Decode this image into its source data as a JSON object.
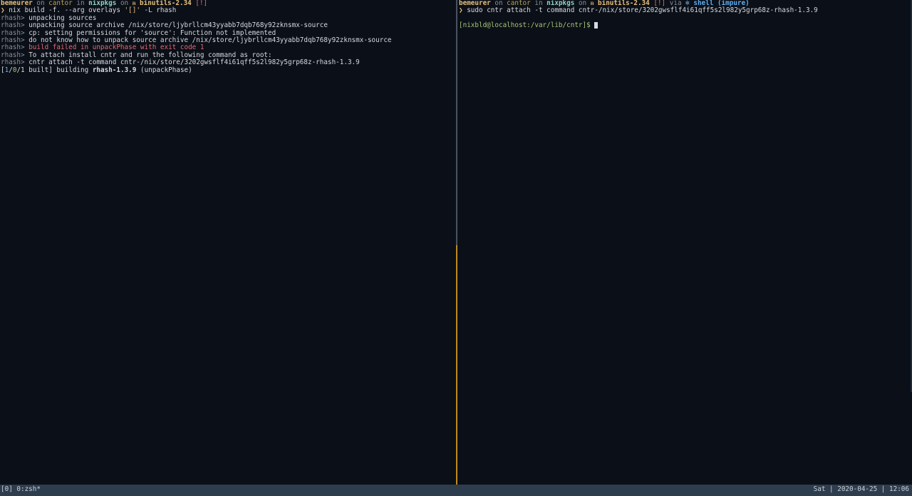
{
  "left_pane": {
    "prompt": {
      "user": "bemeurer",
      "on1": " on ",
      "host": "cantor",
      "in": " in ",
      "dir": "nixpkgs",
      "on2": " on ",
      "branch_icon": "ᵰ",
      "branch": "binutils-2.34",
      "status": " [!]"
    },
    "command": {
      "arrow": "❯",
      "text": " nix build -f. --arg overlays ",
      "quoted": "'[]'",
      "rest": " -L rhash"
    },
    "log": [
      {
        "prefix": "rhash> ",
        "text": "unpacking sources",
        "color": "white"
      },
      {
        "prefix": "rhash> ",
        "text": "unpacking source archive /nix/store/ljybrllcm43yyabb7dqb768y92zknsmx-source",
        "color": "white"
      },
      {
        "prefix": "rhash> ",
        "text": "cp: setting permissions for 'source': Function not implemented",
        "color": "white"
      },
      {
        "prefix": "rhash> ",
        "text": "do not know how to unpack source archive /nix/store/ljybrllcm43yyabb7dqb768y92zknsmx-source",
        "color": "white"
      },
      {
        "prefix": "rhash> ",
        "text": "build failed in unpackPhase with exit code 1",
        "color": "red"
      },
      {
        "prefix": "rhash> ",
        "text": "To attach install cntr and run the following command as root:",
        "color": "white"
      },
      {
        "prefix": "rhash> ",
        "text": "cntr attach -t command cntr-/nix/store/3202gwsflf4i61qff5s2l982y5grp68z-rhash-1.3.9",
        "color": "white"
      }
    ],
    "progress": {
      "open": "[",
      "done": "1",
      "sep1": "/",
      "running": "0",
      "sep2": "/",
      "total": "1",
      "label": " built] building ",
      "pkg": "rhash-1.3.9",
      "phase": " (unpackPhase)"
    }
  },
  "right_pane": {
    "prompt": {
      "user": "bemeurer",
      "on1": " on ",
      "host": "cantor",
      "in": " in ",
      "dir": "nixpkgs",
      "on2": " on ",
      "branch_icon": "ᵰ",
      "branch": "binutils-2.34",
      "status": " [!]",
      "via": " via ",
      "nix_icon": "❄",
      "shell": " shell (impure)"
    },
    "command": {
      "arrow": "❯",
      "text": " sudo cntr attach -t command cntr-/nix/store/3202gwsflf4i61qff5s2l982y5grp68z-rhash-1.3.9"
    },
    "shell_prompt": "[nixbld@localhost:/var/lib/cntr]$ "
  },
  "statusbar": {
    "session": "[0] ",
    "window": "0:zsh*",
    "right": "Sat | 2020-04-25 | 12:06"
  },
  "colors": {
    "background": "#0b0f17",
    "statusbar": "#2e3d4e",
    "active_divider": "#c08a1c"
  }
}
